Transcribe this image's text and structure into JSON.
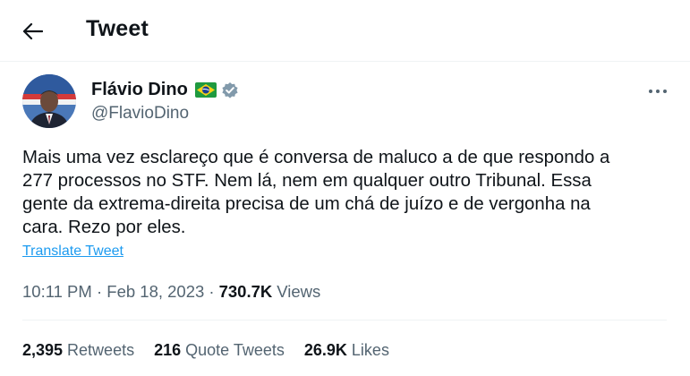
{
  "header": {
    "title": "Tweet",
    "back_icon": "arrow-left-icon"
  },
  "author": {
    "name": "Flávio Dino",
    "handle": "@FlavioDino",
    "flag_icon": "brazil-flag-icon",
    "verified_icon": "verified-badge-icon"
  },
  "tweet": {
    "text": "Mais uma vez esclareço que é conversa de maluco a de que respondo a\n277 processos no STF. Nem lá, nem em qualquer outro Tribunal. Essa\ngente da extrema-direita precisa de um chá de juízo e de vergonha na\ncara. Rezo por eles.",
    "translate_label": "Translate Tweet",
    "time": "10:11 PM",
    "date": "Feb 18, 2023",
    "views_count": "730.7K",
    "views_label": "Views"
  },
  "stats": {
    "retweets_count": "2,395",
    "retweets_label": "Retweets",
    "quotes_count": "216",
    "quotes_label": "Quote Tweets",
    "likes_count": "26.9K",
    "likes_label": "Likes"
  },
  "colors": {
    "link": "#1d9bf0",
    "secondary_text": "#536471",
    "verified": "#829aab"
  }
}
